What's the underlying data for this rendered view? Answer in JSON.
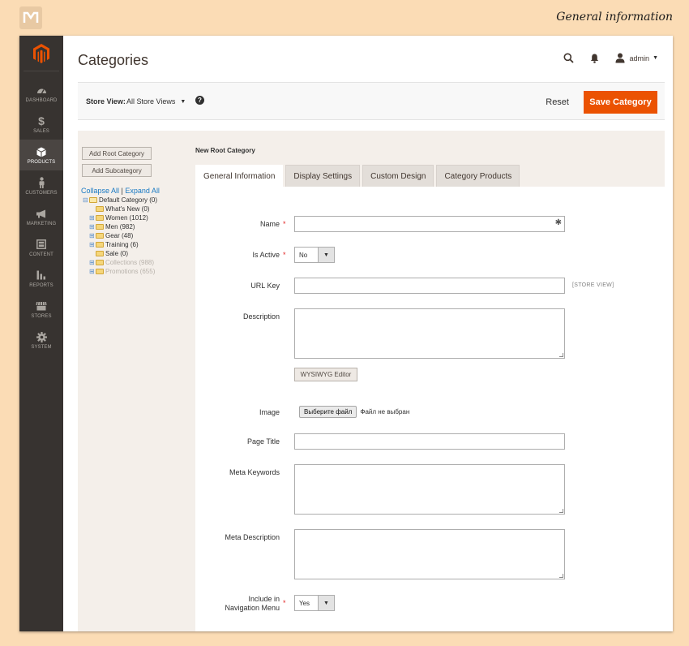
{
  "watermark": {
    "title": "General information"
  },
  "sidebar": {
    "items": [
      {
        "label": "DASHBOARD",
        "icon": "dashboard-icon"
      },
      {
        "label": "SALES",
        "icon": "dollar-icon"
      },
      {
        "label": "PRODUCTS",
        "icon": "cube-icon",
        "active": true
      },
      {
        "label": "CUSTOMERS",
        "icon": "person-icon"
      },
      {
        "label": "MARKETING",
        "icon": "megaphone-icon"
      },
      {
        "label": "CONTENT",
        "icon": "layout-icon"
      },
      {
        "label": "REPORTS",
        "icon": "bar-chart-icon"
      },
      {
        "label": "STORES",
        "icon": "store-icon"
      },
      {
        "label": "SYSTEM",
        "icon": "gear-icon"
      }
    ]
  },
  "header": {
    "title": "Categories",
    "user": "admin"
  },
  "scope": {
    "label": "Store View:",
    "value": "All Store Views",
    "help": "?"
  },
  "actions": {
    "reset": "Reset",
    "save": "Save Category"
  },
  "tree": {
    "add_root": "Add Root Category",
    "add_sub": "Add Subcategory",
    "collapse": "Collapse All",
    "sep": "|",
    "expand": "Expand All",
    "nodes": [
      {
        "label": "Default Category (0)",
        "level": 0,
        "toggle": "⊟",
        "open": true
      },
      {
        "label": "What's New (0)",
        "level": 1,
        "toggle": ""
      },
      {
        "label": "Women (1012)",
        "level": 1,
        "toggle": "⊞"
      },
      {
        "label": "Men (982)",
        "level": 1,
        "toggle": "⊞"
      },
      {
        "label": "Gear (48)",
        "level": 1,
        "toggle": "⊞"
      },
      {
        "label": "Training (6)",
        "level": 1,
        "toggle": "⊞"
      },
      {
        "label": "Sale (0)",
        "level": 1,
        "toggle": ""
      },
      {
        "label": "Collections (988)",
        "level": 1,
        "toggle": "⊞",
        "disabled": true
      },
      {
        "label": "Promotions (655)",
        "level": 1,
        "toggle": "⊞",
        "disabled": true
      }
    ]
  },
  "form": {
    "heading": "New Root Category",
    "tabs": [
      "General Information",
      "Display Settings",
      "Custom Design",
      "Category Products"
    ],
    "active_tab": 0,
    "required_mark": "*",
    "name": {
      "label": "Name",
      "value": ""
    },
    "is_active": {
      "label": "Is Active",
      "value": "No"
    },
    "url_key": {
      "label": "URL Key",
      "value": "",
      "scope_note": "[STORE VIEW]"
    },
    "description": {
      "label": "Description",
      "value": "",
      "editor_button": "WYSIWYG Editor"
    },
    "image": {
      "label": "Image",
      "choose_button": "Выберите файл",
      "no_file": "Файл не выбран"
    },
    "page_title": {
      "label": "Page Title",
      "value": ""
    },
    "meta_keywords": {
      "label": "Meta Keywords",
      "value": ""
    },
    "meta_description": {
      "label": "Meta Description",
      "value": ""
    },
    "include_nav": {
      "label": "Include in Navigation Menu",
      "value": "Yes"
    }
  },
  "colors": {
    "accent": "#eb5202",
    "sidebar": "#373330",
    "link": "#1979c3",
    "required": "#e22626",
    "page_bg": "#fbdcb5"
  }
}
